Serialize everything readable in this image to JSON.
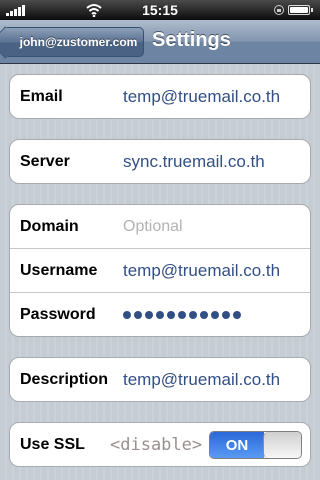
{
  "status_bar": {
    "time": "15:15",
    "signal_icon": "signal-bars-icon",
    "wifi_icon": "wifi-icon",
    "lock_icon": "rotation-lock-icon",
    "battery_icon": "battery-icon"
  },
  "nav": {
    "back_label": "john@zustomer.com",
    "title": "Settings"
  },
  "account": {
    "email": {
      "label": "Email",
      "value": "temp@truemail.co.th"
    },
    "server": {
      "label": "Server",
      "value": "sync.truemail.co.th"
    },
    "domain": {
      "label": "Domain",
      "placeholder": "Optional"
    },
    "username": {
      "label": "Username",
      "value": "temp@truemail.co.th"
    },
    "password": {
      "label": "Password",
      "masked_length": 11
    },
    "description": {
      "label": "Description",
      "value": "temp@truemail.co.th"
    },
    "ssl": {
      "label": "Use SSL",
      "note": "<disable>",
      "switch_label": "ON",
      "enabled": true
    }
  },
  "colors": {
    "value_text": "#324f85",
    "switch_on": "#2b68d9",
    "nav_bar": "#6d84a2"
  }
}
